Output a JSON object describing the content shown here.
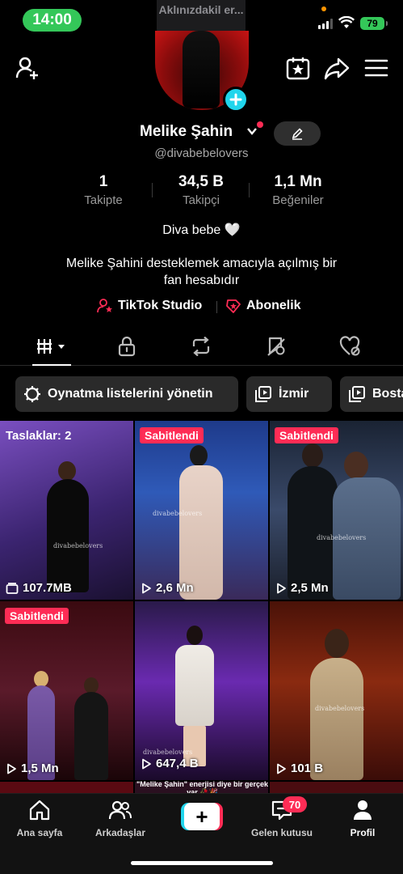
{
  "status": {
    "time": "14:00",
    "notification": "Aklınızdakil er...",
    "battery": "79"
  },
  "header": {
    "icons": [
      "add-user-icon",
      "star-calendar-icon",
      "share-icon",
      "menu-icon"
    ]
  },
  "profile": {
    "name": "Melike Şahin",
    "handle": "@divabebelovers",
    "stats": [
      {
        "value": "1",
        "label": "Takipte"
      },
      {
        "value": "34,5 B",
        "label": "Takipçi"
      },
      {
        "value": "1,1 Mn",
        "label": "Beğeniler"
      }
    ],
    "bio_line1": "Diva bebe 🤍",
    "bio_line2": "Melike Şahini desteklemek amacıyla açılmış bir",
    "bio_line3": "fan hesabıdır",
    "links": [
      {
        "label": "TikTok Studio",
        "icon": "studio-icon"
      },
      {
        "label": "Abonelik",
        "icon": "subscription-icon"
      }
    ]
  },
  "tabs": [
    "videos-tab",
    "private-tab",
    "reposts-tab",
    "favorites-tab",
    "liked-tab"
  ],
  "playlists": [
    {
      "label": "Oynatma listelerini yönetin",
      "icon": "gear-icon"
    },
    {
      "label": "İzmir",
      "icon": "playlist-icon"
    },
    {
      "label": "Bostan",
      "icon": "playlist-icon"
    }
  ],
  "videos": [
    {
      "draft": "Taslaklar: 2",
      "views": "107.7MB",
      "tag": ""
    },
    {
      "tag": "Sabitlendi",
      "views": "2,6 Mn",
      "watermark": "divabebelovers"
    },
    {
      "tag": "Sabitlendi",
      "views": "2,5 Mn",
      "watermark": "divabebelovers"
    },
    {
      "tag": "Sabitlendi",
      "views": "1,5 Mn"
    },
    {
      "tag": "",
      "views": "647,4 B",
      "caption": "\"Melike Şahin\" enerjisi diye bir gerçek var 🥀🎉"
    },
    {
      "tag": "",
      "views": "101 B",
      "watermark": "divabebelovers"
    }
  ],
  "grid_watermark": "divabebelovers",
  "nav": {
    "items": [
      {
        "label": "Ana sayfa",
        "icon": "home-icon"
      },
      {
        "label": "Arkadaşlar",
        "icon": "friends-icon"
      },
      {
        "label": "",
        "icon": "create-icon"
      },
      {
        "label": "Gelen kutusu",
        "icon": "inbox-icon"
      },
      {
        "label": "Profil",
        "icon": "profile-icon"
      }
    ],
    "inbox_badge": "70",
    "create_symbol": "+"
  },
  "colors": {
    "accent_pink": "#fe2c55",
    "accent_cyan": "#20d5ec",
    "status_green": "#34c759"
  }
}
